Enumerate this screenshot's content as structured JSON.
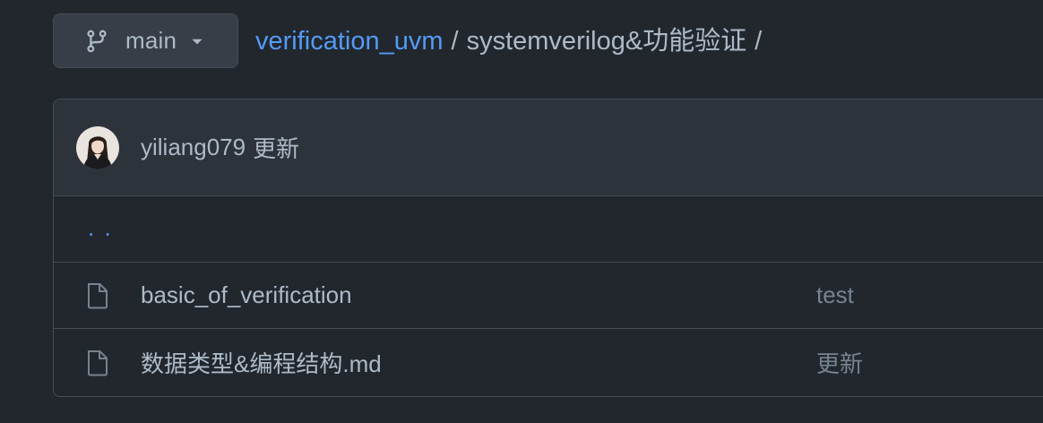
{
  "branch": {
    "icon": "git-branch-icon",
    "name": "main",
    "caret_icon": "caret-down-icon"
  },
  "breadcrumb": {
    "repo": "verification_uvm",
    "separator": "/",
    "folder": "systemverilog&功能验证",
    "trailing_separator": "/"
  },
  "latest_commit": {
    "avatar_icon": "user-avatar",
    "author": "yiliang079",
    "message": "更新"
  },
  "parent_dir": {
    "label": ". ."
  },
  "files": [
    {
      "icon": "file-icon",
      "name": "basic_of_verification",
      "commit_message": "test"
    },
    {
      "icon": "file-icon",
      "name": "数据类型&编程结构.md",
      "commit_message": "更新"
    }
  ],
  "colors": {
    "background": "#22272e",
    "header_row": "#2d333b",
    "border": "#444c56",
    "link": "#539bf5",
    "text": "#adbac7",
    "muted": "#768390"
  }
}
